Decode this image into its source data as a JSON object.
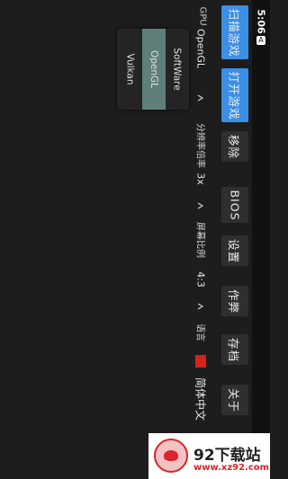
{
  "status_bar": {
    "time": "5:06",
    "icon": "notification-icon"
  },
  "menu": {
    "scan_games": "扫描游戏",
    "open_game": "打开游戏",
    "remove": "移除",
    "bios": "BIOS",
    "settings": "设置",
    "cheats": "作弊",
    "saves": "存档",
    "about": "关于"
  },
  "settings": {
    "gpu": {
      "label": "GPU",
      "value": "OpenGL"
    },
    "resolution": {
      "label": "分辨率倍率",
      "value": "3x"
    },
    "aspect": {
      "label": "屏幕比例",
      "value": "4:3"
    },
    "language": {
      "label": "语言",
      "value": "简体中文",
      "flag_color": "#d3231b"
    }
  },
  "gpu_dropdown": {
    "options": [
      "SoftWare",
      "OpenGL",
      "Vulkan"
    ],
    "selected": "OpenGL"
  },
  "watermark": {
    "title": "92下载站",
    "url": "www.xz92.com"
  },
  "colors": {
    "accent": "#3d8fe6",
    "background": "#1d1d1d",
    "selected_option": "#5e7f7a"
  }
}
